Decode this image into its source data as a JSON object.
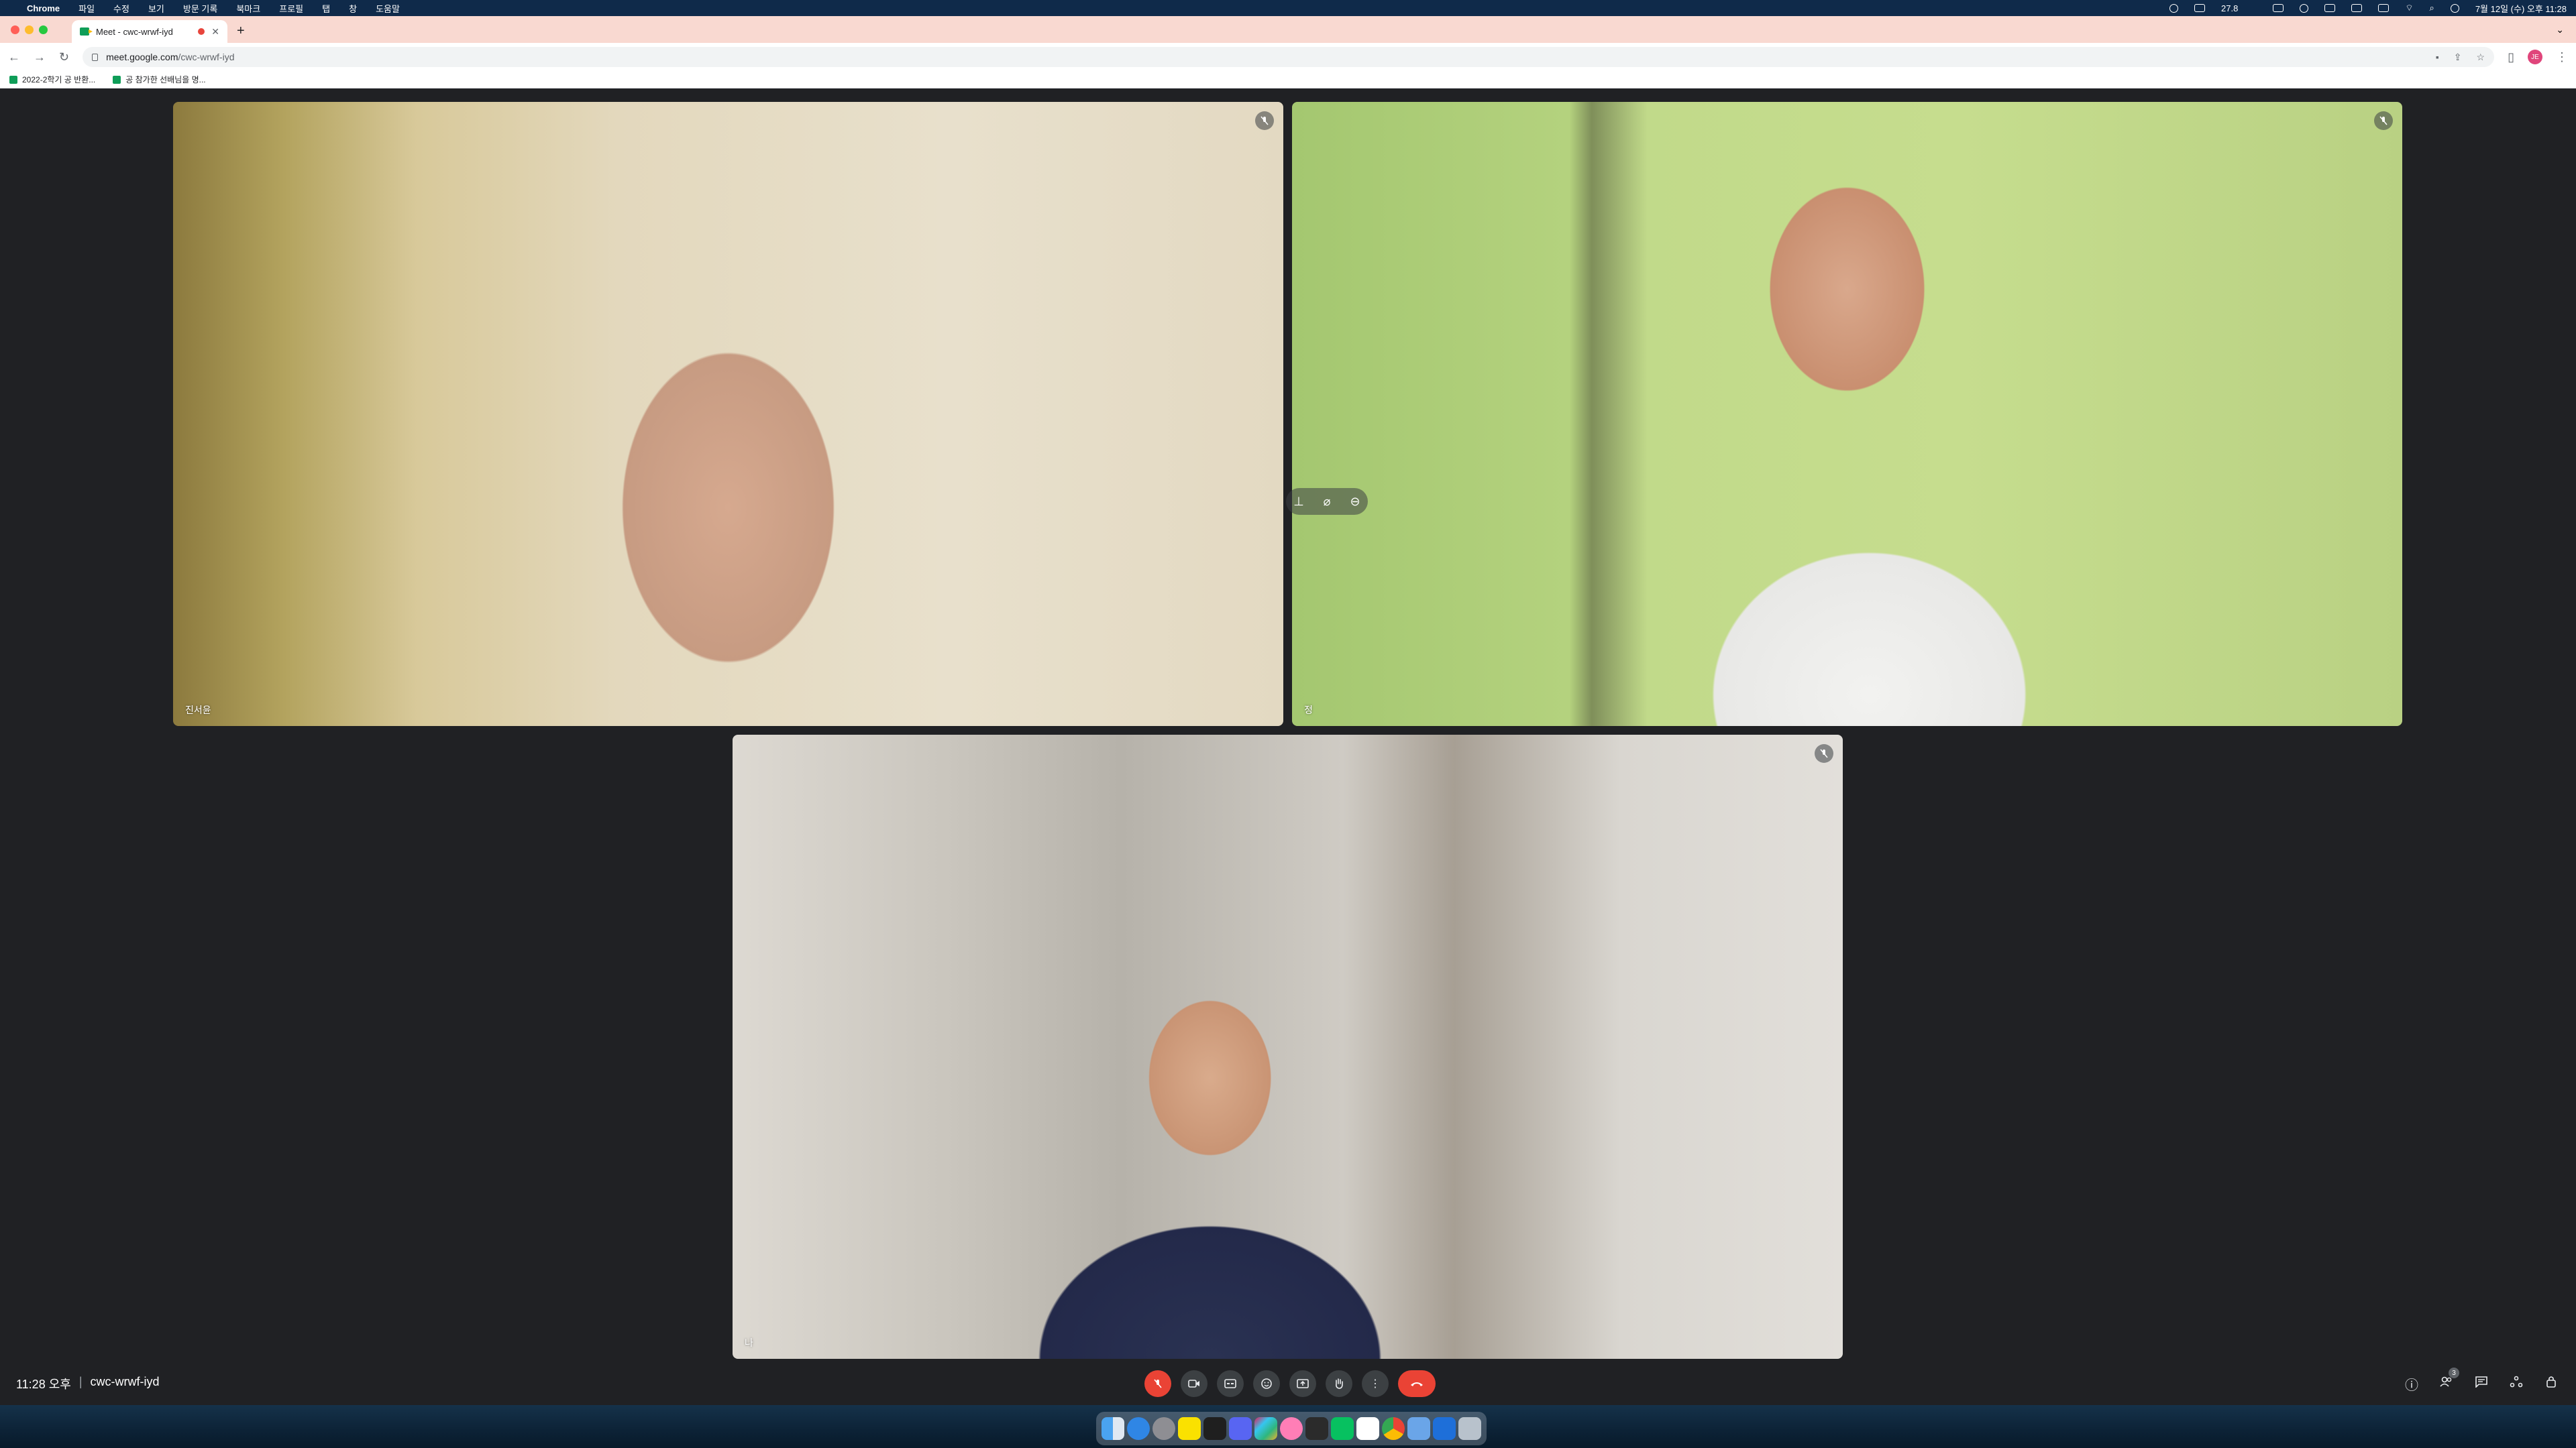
{
  "menubar": {
    "app": "Chrome",
    "menus": [
      "파일",
      "수정",
      "보기",
      "방문 기록",
      "북마크",
      "프로필",
      "탭",
      "창",
      "도움말"
    ],
    "datetime": "7월 12일 (수) 오후 11:28",
    "battery_label": "27.8"
  },
  "tab": {
    "title": "Meet - cwc-wrwf-iyd",
    "new_tab": "+"
  },
  "toolbar": {
    "url_host": "meet.google.com",
    "url_path": "/cwc-wrwf-iyd",
    "profile_initials": "JE"
  },
  "bookmarks": [
    {
      "label": "2022-2학기 공 반환..."
    },
    {
      "label": "공 참가한 선배님을 명..."
    }
  ],
  "participants": [
    {
      "name": "진서윤",
      "muted": true
    },
    {
      "name": "정",
      "muted": true
    },
    {
      "name": "나",
      "muted": true
    }
  ],
  "meeting": {
    "time": "11:28 오후",
    "separator": "|",
    "code": "cwc-wrwf-iyd",
    "participant_count": "3"
  },
  "controls": {
    "mic": "mic-off-icon",
    "camera": "camera-icon",
    "captions": "captions-icon",
    "emoji": "emoji-icon",
    "present": "present-screen-icon",
    "raise_hand": "raise-hand-icon",
    "more": "more-options-icon",
    "end_call": "end-call-icon"
  },
  "colors": {
    "meet_background": "#202124",
    "end_call_red": "#ea4335",
    "control_grey": "#3c4043",
    "tab_strip": "#f9d9d1"
  }
}
